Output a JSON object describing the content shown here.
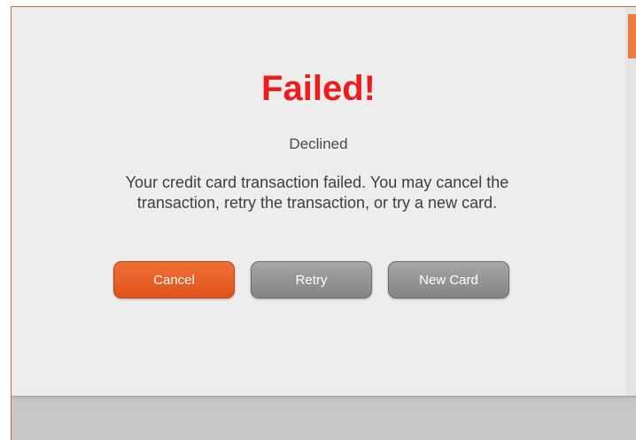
{
  "dialog": {
    "title": "Failed!",
    "status": "Declined",
    "message": "Your credit card transaction failed. You may cancel the transaction, retry the transaction, or try a new card."
  },
  "buttons": {
    "cancel_label": "Cancel",
    "retry_label": "Retry",
    "new_card_label": "New Card"
  },
  "colors": {
    "title": "#ef1c1c",
    "accent": "#e55b22",
    "secondary_button": "#949494"
  }
}
